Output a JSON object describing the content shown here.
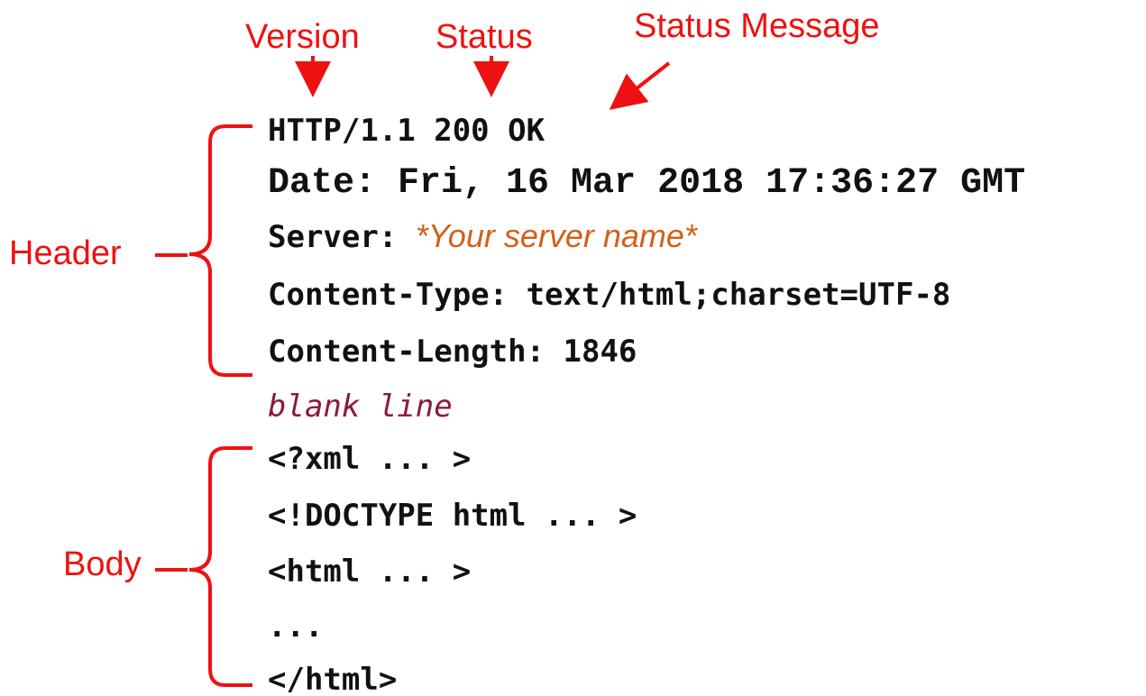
{
  "annotations": {
    "version": "Version",
    "status": "Status",
    "status_message": "Status Message",
    "header": "Header",
    "body": "Body"
  },
  "response": {
    "status_line": "HTTP/1.1 200 OK",
    "date_line": "Date: Fri, 16 Mar 2018 17:36:27 GMT",
    "server_label": "Server: ",
    "server_value": "*Your server name*",
    "content_type_line": "Content-Type: text/html;charset=UTF-8",
    "content_length_line": "Content-Length: 1846",
    "blank_line": "blank line",
    "body_lines": [
      "<?xml ... >",
      "<!DOCTYPE html ... >",
      "<html ... >",
      "...",
      "</html>"
    ]
  },
  "colors": {
    "annotation": "#ee1111",
    "code_text": "#111111",
    "server_value": "#d2601a",
    "blank_line": "#8b1a3a"
  }
}
